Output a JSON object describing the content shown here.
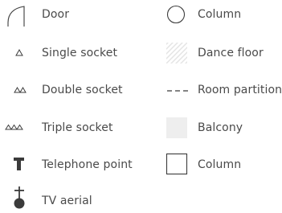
{
  "legend": {
    "colors": {
      "symbol_stroke": "#3b3b3b",
      "text": "#4a4a4a",
      "dance_floor_hatch": "#e4e4e4",
      "balcony_fill": "#eeeeee"
    },
    "items": [
      {
        "key": "door",
        "label": "Door",
        "icon": "door-arc-icon"
      },
      {
        "key": "column_round",
        "label": "Column",
        "icon": "circle-column-icon"
      },
      {
        "key": "single_socket",
        "label": "Single socket",
        "icon": "single-socket-icon"
      },
      {
        "key": "dance_floor",
        "label": "Dance floor",
        "icon": "hatched-square-icon"
      },
      {
        "key": "double_socket",
        "label": "Double socket",
        "icon": "double-socket-icon"
      },
      {
        "key": "room_partition",
        "label": "Room partition",
        "icon": "dashed-line-icon"
      },
      {
        "key": "triple_socket",
        "label": "Triple socket",
        "icon": "triple-socket-icon"
      },
      {
        "key": "balcony",
        "label": "Balcony",
        "icon": "grey-square-icon"
      },
      {
        "key": "telephone_point",
        "label": "Telephone point",
        "icon": "telephone-t-icon"
      },
      {
        "key": "column_square",
        "label": "Column",
        "icon": "square-column-icon"
      },
      {
        "key": "tv_aerial",
        "label": "TV aerial",
        "icon": "tv-aerial-icon"
      }
    ]
  }
}
